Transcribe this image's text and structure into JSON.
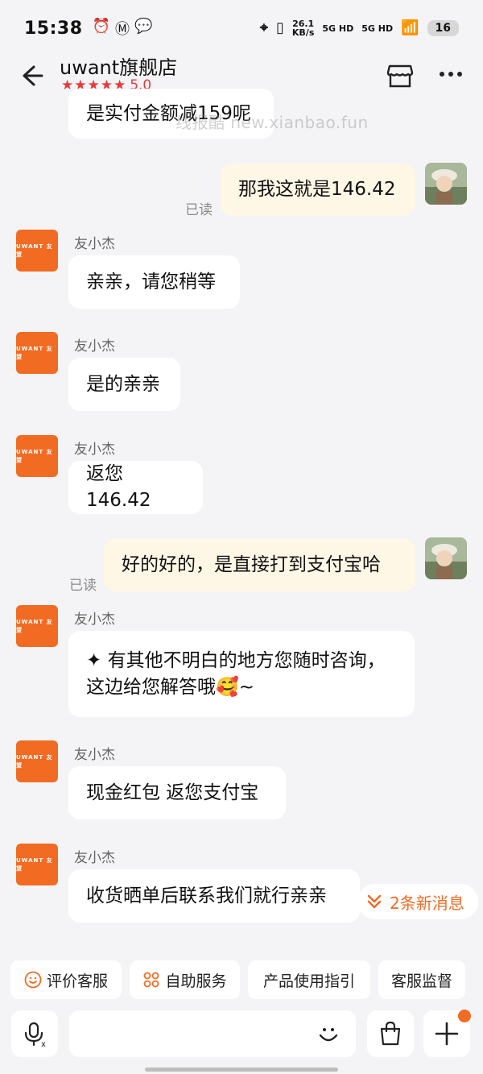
{
  "status": {
    "time": "15:38",
    "net_speed": "26.1",
    "net_unit": "KB/s",
    "sig1": "5G HD",
    "sig2": "5G HD",
    "battery": "16"
  },
  "header": {
    "title": "uwant旗舰店",
    "stars": "★★★★★",
    "score": "5.0"
  },
  "watermark": "线报酷 new.xianbao.fun",
  "shop_avatar_text": "UWANT 友望",
  "messages": [
    {
      "from": "shop",
      "text": "是实付金额减159呢"
    },
    {
      "from": "me",
      "text": "那我这就是146.42",
      "read": "已读"
    },
    {
      "from": "shop",
      "sender": "友小杰",
      "text": "亲亲，请您稍等"
    },
    {
      "from": "shop",
      "sender": "友小杰",
      "text": "是的亲亲"
    },
    {
      "from": "shop",
      "sender": "友小杰",
      "text": "返您146.42"
    },
    {
      "from": "me",
      "text": "好的好的，是直接打到支付宝哈",
      "read": "已读"
    },
    {
      "from": "shop",
      "sender": "友小杰",
      "line1": "✦ 有其他不明白的地方您随时咨询，",
      "line2": "这边给您解答哦🥰~"
    },
    {
      "from": "shop",
      "sender": "友小杰",
      "text": "现金红包 返您支付宝"
    },
    {
      "from": "shop",
      "sender": "友小杰",
      "text": "收货晒单后联系我们就行亲亲"
    }
  ],
  "new_messages": "2条新消息",
  "quick_actions": [
    {
      "icon": "smile-icon",
      "label": "评价客服"
    },
    {
      "icon": "grid-icon",
      "label": "自助服务"
    },
    {
      "label": "产品使用指引"
    },
    {
      "label": "客服监督"
    }
  ],
  "colors": {
    "accent": "#f26b23",
    "rating": "#e73a3a",
    "my_bubble": "#fff7e6"
  }
}
